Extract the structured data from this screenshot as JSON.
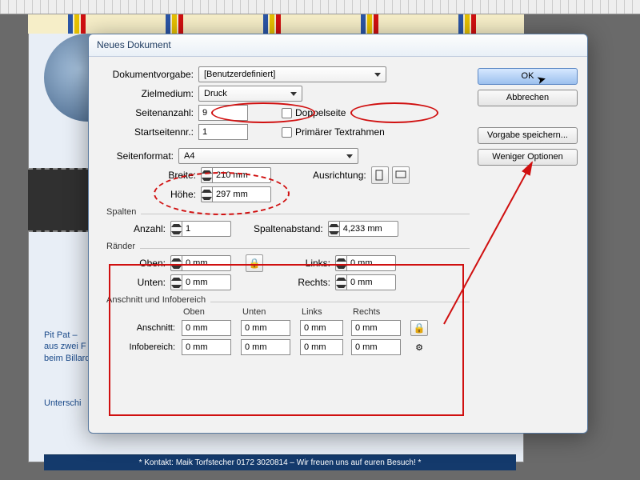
{
  "bg": {
    "text1_l1": "Pit Pat –",
    "text1_l2": "aus zwei F",
    "text1_l3": "beim Billard",
    "text2": "Unterschi",
    "footer": "* Kontakt: Maik Torfstecher 0172 3020814 – Wir freuen uns auf euren Besuch! *"
  },
  "dialog": {
    "title": "Neues Dokument",
    "buttons": {
      "ok": "OK",
      "cancel": "Abbrechen",
      "save_preset": "Vorgabe speichern...",
      "less_options": "Weniger Optionen"
    },
    "labels": {
      "doc_preset": "Dokumentvorgabe:",
      "intent": "Zielmedium:",
      "pages": "Seitenanzahl:",
      "start_page": "Startseitennr.:",
      "facing_pages": "Doppelseite",
      "primary_frame": "Primärer Textrahmen",
      "page_size": "Seitenformat:",
      "width": "Breite:",
      "height": "Höhe:",
      "orientation": "Ausrichtung:",
      "columns_section": "Spalten",
      "columns_count": "Anzahl:",
      "columns_gutter": "Spaltenabstand:",
      "margins_section": "Ränder",
      "m_top": "Oben:",
      "m_bottom": "Unten:",
      "m_left": "Links:",
      "m_right": "Rechts:",
      "bleed_section": "Anschnitt und Infobereich",
      "b_col_top": "Oben",
      "b_col_bot": "Unten",
      "b_col_left": "Links",
      "b_col_right": "Rechts",
      "b_row_bleed": "Anschnitt:",
      "b_row_slug": "Infobereich:"
    },
    "values": {
      "doc_preset": "[Benutzerdefiniert]",
      "intent": "Druck",
      "pages": "9",
      "start_page": "1",
      "page_size": "A4",
      "width": "210 mm",
      "height": "297 mm",
      "columns_count": "1",
      "columns_gutter": "4,233 mm",
      "m_top": "0 mm",
      "m_bottom": "0 mm",
      "m_left": "0 mm",
      "m_right": "0 mm",
      "bleed_top": "0 mm",
      "bleed_bot": "0 mm",
      "bleed_left": "0 mm",
      "bleed_right": "0 mm",
      "slug_top": "0 mm",
      "slug_bot": "0 mm",
      "slug_left": "0 mm",
      "slug_right": "0 mm"
    }
  }
}
